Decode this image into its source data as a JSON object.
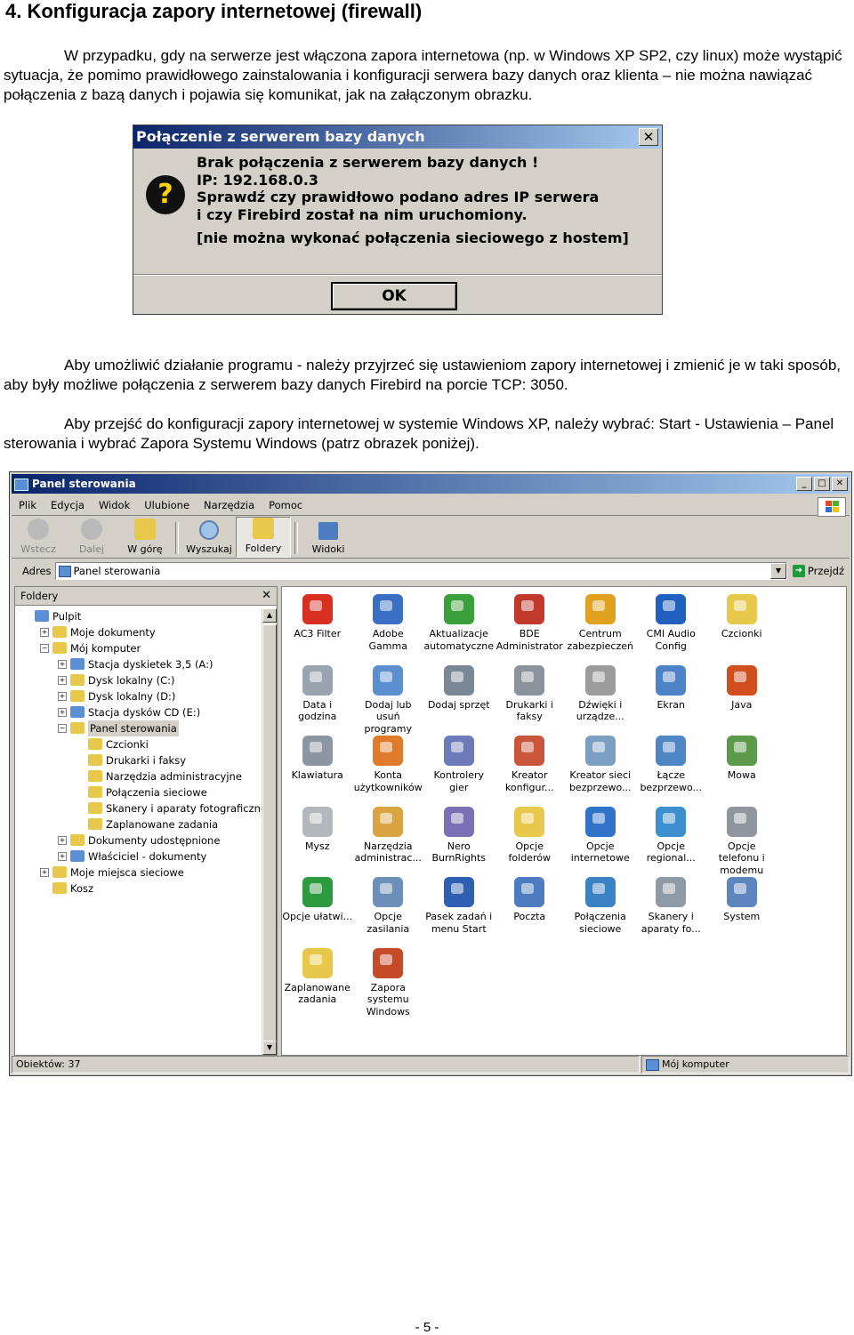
{
  "heading": "4. Konfiguracja zapory internetowej (firewall)",
  "paragraphs": {
    "p1": "W przypadku, gdy na serwerze jest włączona zapora internetowa (np. w Windows XP SP2, czy linux) może wystąpić sytuacja, że pomimo prawidłowego zainstalowania i konfiguracji serwera bazy danych oraz klienta – nie można nawiązać połączenia z bazą danych i pojawia się komunikat, jak na załączonym obrazku.",
    "p2": "Aby umożliwić działanie programu - należy przyjrzeć się ustawieniom zapory internetowej i zmienić je w taki sposób, aby były możliwe połączenia z serwerem bazy danych Firebird na porcie TCP: 3050.",
    "p3": "Aby przejść do konfiguracji zapory internetowej w systemie Windows XP, należy wybrać: Start - Ustawienia – Panel sterowania i wybrać Zapora Systemu Windows (patrz obrazek poniżej)."
  },
  "dialog": {
    "title": "Połączenie z serwerem bazy danych",
    "close": "✕",
    "icon_glyph": "?",
    "lines": [
      "Brak połączenia z serwerem bazy danych !",
      "IP: 192.168.0.3",
      "Sprawdź czy prawidłowo podano adres IP serwera",
      "i czy Firebird został na nim uruchomiony.",
      "[nie można wykonać połączenia sieciowego z hostem]"
    ],
    "ok": "OK"
  },
  "explorer": {
    "title": "Panel sterowania",
    "window_buttons": [
      "_",
      "□",
      "✕"
    ],
    "menu": [
      "Plik",
      "Edycja",
      "Widok",
      "Ulubione",
      "Narzędzia",
      "Pomoc"
    ],
    "toolbar": {
      "back": "Wstecz",
      "forward": "Dalej",
      "up": "W górę",
      "search": "Wyszukaj",
      "folders": "Foldery",
      "views": "Widoki"
    },
    "address_label": "Adres",
    "address_value": "Panel sterowania",
    "go_label": "Przejdź",
    "folders_pane_title": "Foldery",
    "tree": [
      {
        "label": "Pulpit",
        "level": 0,
        "exp": ""
      },
      {
        "label": "Moje dokumenty",
        "level": 1,
        "exp": "+"
      },
      {
        "label": "Mój komputer",
        "level": 1,
        "exp": "−"
      },
      {
        "label": "Stacja dyskietek 3,5 (A:)",
        "level": 2,
        "exp": "+"
      },
      {
        "label": "Dysk lokalny (C:)",
        "level": 2,
        "exp": "+"
      },
      {
        "label": "Dysk lokalny (D:)",
        "level": 2,
        "exp": "+"
      },
      {
        "label": "Stacja dysków CD (E:)",
        "level": 2,
        "exp": "+"
      },
      {
        "label": "Panel sterowania",
        "level": 2,
        "exp": "−"
      },
      {
        "label": "Czcionki",
        "level": 3,
        "exp": ""
      },
      {
        "label": "Drukarki i faksy",
        "level": 3,
        "exp": ""
      },
      {
        "label": "Narzędzia administracyjne",
        "level": 3,
        "exp": ""
      },
      {
        "label": "Połączenia sieciowe",
        "level": 3,
        "exp": ""
      },
      {
        "label": "Skanery i aparaty fotograficzne",
        "level": 3,
        "exp": ""
      },
      {
        "label": "Zaplanowane zadania",
        "level": 3,
        "exp": ""
      },
      {
        "label": "Dokumenty udostępnione",
        "level": 2,
        "exp": "+"
      },
      {
        "label": "Właściciel - dokumenty",
        "level": 2,
        "exp": "+"
      },
      {
        "label": "Moje miejsca sieciowe",
        "level": 1,
        "exp": "+"
      },
      {
        "label": "Kosz",
        "level": 1,
        "exp": ""
      }
    ],
    "selected_tree_item": "Panel sterowania",
    "items": [
      {
        "label": "AC3 Filter",
        "icon": "ac3-filter-icon",
        "color": "#d83020"
      },
      {
        "label": "Adobe Gamma",
        "icon": "monitor-icon",
        "color": "#3a6fc4"
      },
      {
        "label": "Aktualizacje automatyczne",
        "icon": "windows-update-icon",
        "color": "#3ba03b"
      },
      {
        "label": "BDE Administrator",
        "icon": "bde-administrator-icon",
        "color": "#c0392b"
      },
      {
        "label": "Centrum zabezpieczeń",
        "icon": "shield-icon",
        "color": "#e0a020"
      },
      {
        "label": "CMI Audio Config",
        "icon": "xear-icon",
        "color": "#2060c0"
      },
      {
        "label": "Czcionki",
        "icon": "fonts-folder-icon",
        "color": "#e8c84a"
      },
      {
        "label": "Data i godzina",
        "icon": "clock-icon",
        "color": "#9aa4b0"
      },
      {
        "label": "Dodaj lub usuń programy",
        "icon": "add-remove-programs-icon",
        "color": "#5b8fd0"
      },
      {
        "label": "Dodaj sprzęt",
        "icon": "add-hardware-icon",
        "color": "#7a8896"
      },
      {
        "label": "Drukarki i faksy",
        "icon": "printer-icon",
        "color": "#8a939c"
      },
      {
        "label": "Dźwięki i urządze...",
        "icon": "speaker-icon",
        "color": "#9c9c9c"
      },
      {
        "label": "Ekran",
        "icon": "display-icon",
        "color": "#4d82c8"
      },
      {
        "label": "Java",
        "icon": "java-icon",
        "color": "#d14e1e"
      },
      {
        "label": "Klawiatura",
        "icon": "keyboard-icon",
        "color": "#8b96a2"
      },
      {
        "label": "Konta użytkowników",
        "icon": "user-accounts-icon",
        "color": "#e07b2c"
      },
      {
        "label": "Kontrolery gier",
        "icon": "gamepad-icon",
        "color": "#6c7bb8"
      },
      {
        "label": "Kreator konfigur...",
        "icon": "home-network-icon",
        "color": "#c9553a"
      },
      {
        "label": "Kreator sieci bezprzewo...",
        "icon": "wireless-network-icon",
        "color": "#7a9fc2"
      },
      {
        "label": "Łącze bezprzewo...",
        "icon": "wireless-link-icon",
        "color": "#4f86c6"
      },
      {
        "label": "Mowa",
        "icon": "speech-icon",
        "color": "#5a9a4a"
      },
      {
        "label": "Mysz",
        "icon": "mouse-icon",
        "color": "#b4b8bc"
      },
      {
        "label": "Narzędzia administrac...",
        "icon": "admin-tools-icon",
        "color": "#d9a441"
      },
      {
        "label": "Nero BurnRights",
        "icon": "nero-icon",
        "color": "#7b6fb5"
      },
      {
        "label": "Opcje folderów",
        "icon": "folder-options-icon",
        "color": "#e8c84a"
      },
      {
        "label": "Opcje internetowe",
        "icon": "globe-icon",
        "color": "#2f74c9"
      },
      {
        "label": "Opcje regional...",
        "icon": "regional-globe-icon",
        "color": "#3d8fcf"
      },
      {
        "label": "Opcje telefonu i modemu",
        "icon": "phone-icon",
        "color": "#8f969d"
      },
      {
        "label": "Opcje ułatwi...",
        "icon": "accessibility-icon",
        "color": "#2e9a3e"
      },
      {
        "label": "Opcje zasilania",
        "icon": "power-icon",
        "color": "#6b8fb9"
      },
      {
        "label": "Pasek zadań i menu Start",
        "icon": "taskbar-icon",
        "color": "#2f5fb0"
      },
      {
        "label": "Poczta",
        "icon": "mail-icon",
        "color": "#4d7cc0"
      },
      {
        "label": "Połączenia sieciowe",
        "icon": "network-connections-icon",
        "color": "#3b82c4"
      },
      {
        "label": "Skanery i aparaty fo...",
        "icon": "scanner-icon",
        "color": "#8e9aa6"
      },
      {
        "label": "System",
        "icon": "system-icon",
        "color": "#5d86bf"
      },
      {
        "label": "Zaplanowane zadania",
        "icon": "scheduled-tasks-icon",
        "color": "#e8c84a"
      },
      {
        "label": "Zapora systemu Windows",
        "icon": "firewall-icon",
        "color": "#c44a2a"
      }
    ],
    "status_left": "Obiektów: 37",
    "status_right": "Mój komputer"
  },
  "page_number": "- 5 -"
}
